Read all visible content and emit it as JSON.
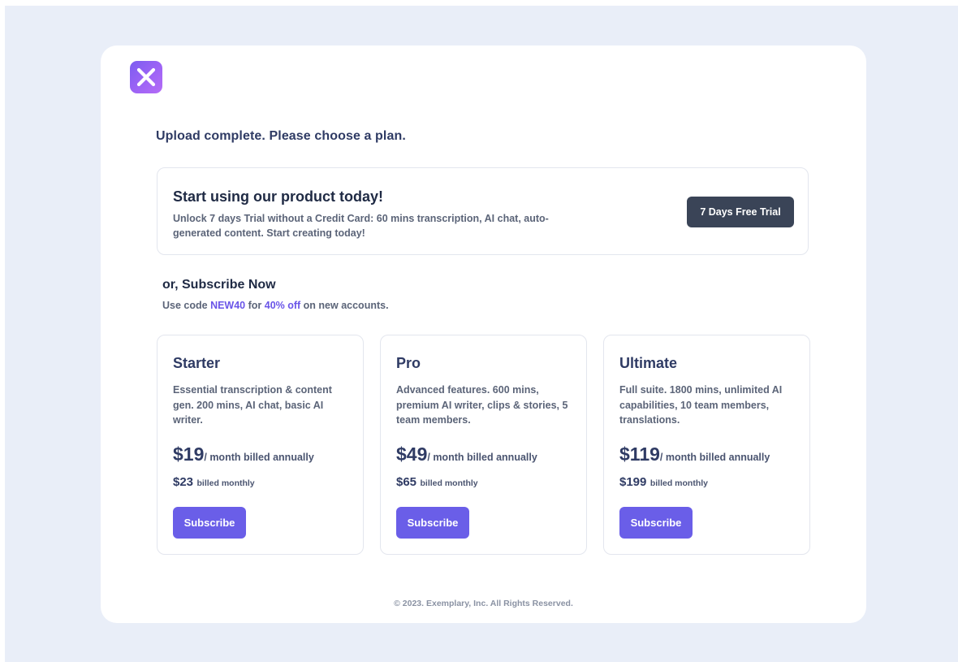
{
  "logo": {
    "icon": "x-logo-icon",
    "gradient": [
      "#7b5cf0",
      "#b56cf7"
    ]
  },
  "heading": "Upload complete. Please choose a plan.",
  "trial": {
    "title": "Start using our product today!",
    "description": "Unlock 7 days Trial without a Credit Card: 60 mins transcription, AI chat, auto-generated content. Start creating today!",
    "button_label": "7 Days Free Trial"
  },
  "subscribe": {
    "title": "or, Subscribe Now",
    "promo_prefix": "Use code ",
    "promo_code": "NEW40",
    "promo_middle": " for ",
    "promo_discount": "40% off",
    "promo_suffix": " on new accounts."
  },
  "plans": [
    {
      "name": "Starter",
      "description": "Essential transcription & content gen. 200 mins, AI chat, basic AI writer.",
      "annual_price": "$19",
      "annual_label": "/ month billed annually",
      "monthly_price": "$23",
      "monthly_label": "billed monthly",
      "button_label": "Subscribe"
    },
    {
      "name": "Pro",
      "description": "Advanced features. 600 mins, premium AI writer, clips & stories, 5 team members.",
      "annual_price": "$49",
      "annual_label": "/ month billed annually",
      "monthly_price": "$65",
      "monthly_label": "billed monthly",
      "button_label": "Subscribe"
    },
    {
      "name": "Ultimate",
      "description": "Full suite. 1800 mins, unlimited AI capabilities, 10 team members, translations.",
      "annual_price": "$119",
      "annual_label": "/ month billed annually",
      "monthly_price": "$199",
      "monthly_label": "billed monthly",
      "button_label": "Subscribe"
    }
  ],
  "footer": "© 2023. Exemplary, Inc. All Rights Reserved.",
  "colors": {
    "page_background": "#e9eef8",
    "accent": "#6a5ee8",
    "trial_button": "#3a4457"
  }
}
